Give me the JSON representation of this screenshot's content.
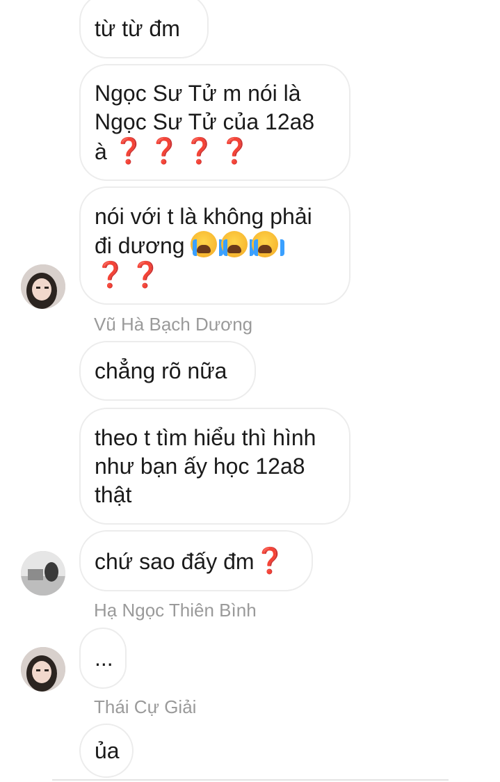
{
  "messages": [
    {
      "text_lines": [
        "từ từ đm"
      ]
    },
    {
      "text_lines": [
        "Ngọc Sư Tử m nói là",
        "Ngọc Sư Tử của 12a8",
        "à"
      ],
      "suffix": "❓❓❓❓"
    },
    {
      "text_lines": [
        "nói với t là không phải",
        "đi dương"
      ],
      "emoji": [
        "loudly-crying-face-icon",
        "loudly-crying-face-icon",
        "loudly-crying-face-icon"
      ],
      "suffix": "❓❓"
    },
    {
      "text_lines": [
        "chẳng rõ nữa"
      ]
    },
    {
      "text_lines": [
        "theo t tìm hiểu thì hình",
        "như bạn ấy học 12a8",
        "thật"
      ]
    },
    {
      "text_lines": [
        "chứ sao đấy đm"
      ],
      "suffix": "❓"
    },
    {
      "text_lines": [
        "..."
      ]
    },
    {
      "text_lines": [
        "ủa"
      ]
    }
  ],
  "senders": [
    "Vũ Hà Bạch Dương",
    "Hạ Ngọc Thiên Bình",
    "Thái Cự Giải"
  ],
  "colors": {
    "bubble_border": "#ececec",
    "sender_text": "#9a9a9a",
    "question_mark": "#d01c2a"
  }
}
